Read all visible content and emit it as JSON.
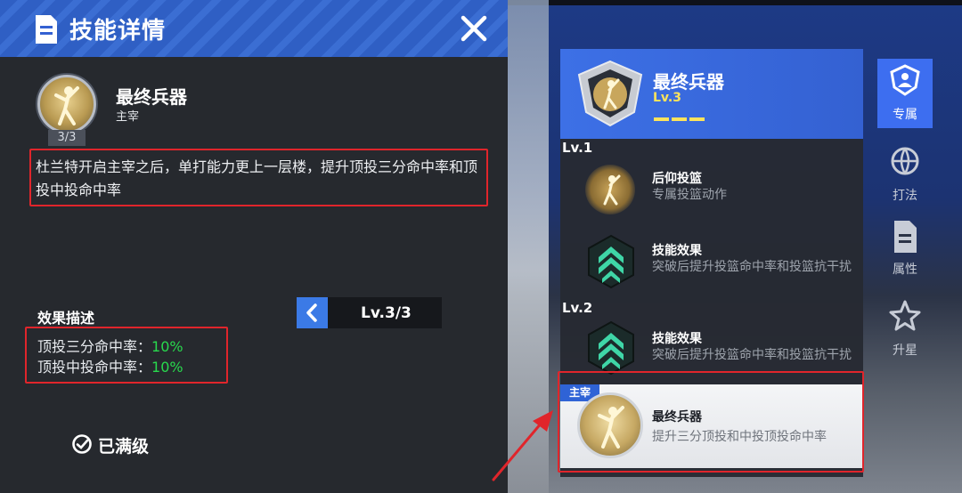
{
  "panel": {
    "title": "技能详情",
    "skill": {
      "name": "最终兵器",
      "type": "主宰",
      "count": "3/3"
    },
    "description": "杜兰特开启主宰之后，单打能力更上一层楼，提升顶投三分命中率和顶投中投命中率",
    "effect": {
      "title": "效果描述",
      "lines": [
        {
          "label": "顶投三分命中率：",
          "value": "10%"
        },
        {
          "label": "顶投中投命中率：",
          "value": "10%"
        }
      ]
    },
    "level_selector": "Lv.3/3",
    "status": "已满级"
  },
  "tree": {
    "title": "最终兵器",
    "level": "Lv.3",
    "level_bars": 3,
    "groups": [
      {
        "label": "Lv.1",
        "nodes": [
          {
            "name": "后仰投篮",
            "desc": "专属投篮动作"
          },
          {
            "name": "技能效果",
            "desc": "突破后提升投篮命中率和投篮抗干扰"
          }
        ]
      },
      {
        "label": "Lv.2",
        "nodes": [
          {
            "name": "技能效果",
            "desc": "突破后提升投篮命中率和投篮抗干扰"
          }
        ]
      }
    ],
    "final": {
      "tag": "主宰",
      "name": "最终兵器",
      "desc": "提升三分顶投和中投顶投命中率"
    }
  },
  "sidebar": {
    "tabs": [
      {
        "label": "专属",
        "icon": "exclusive-icon",
        "active": true
      },
      {
        "label": "打法",
        "icon": "basketball-icon",
        "active": false
      },
      {
        "label": "属性",
        "icon": "attribute-doc-icon",
        "active": false
      },
      {
        "label": "升星",
        "icon": "star-icon",
        "active": false
      }
    ]
  },
  "colors": {
    "accent_blue": "#3d6ef0",
    "highlight_red": "#e0252b",
    "value_green": "#28d94d",
    "level_yellow": "#fde35c"
  }
}
